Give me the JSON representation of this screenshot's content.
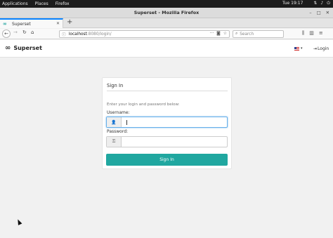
{
  "desktop": {
    "menu": [
      "Applications",
      "Places",
      "Firefox"
    ],
    "clock": "Tue 19:17"
  },
  "browser": {
    "window_title": "Superset - Mozilla Firefox",
    "tab": {
      "title": "Superset"
    },
    "url": {
      "host": "localhost",
      "path": ":8080/login/"
    },
    "search_placeholder": "Search"
  },
  "app": {
    "brand": "Superset",
    "login_link": "Login"
  },
  "login_form": {
    "title": "Sign In",
    "hint": "Enter your login and password below:",
    "username_label": "Username:",
    "username_value": "",
    "password_label": "Password:",
    "password_value": "",
    "submit_label": "Sign In"
  },
  "colors": {
    "accent": "#20a7a0",
    "focus": "#66afe9",
    "firefox_blue": "#0a84ff"
  }
}
